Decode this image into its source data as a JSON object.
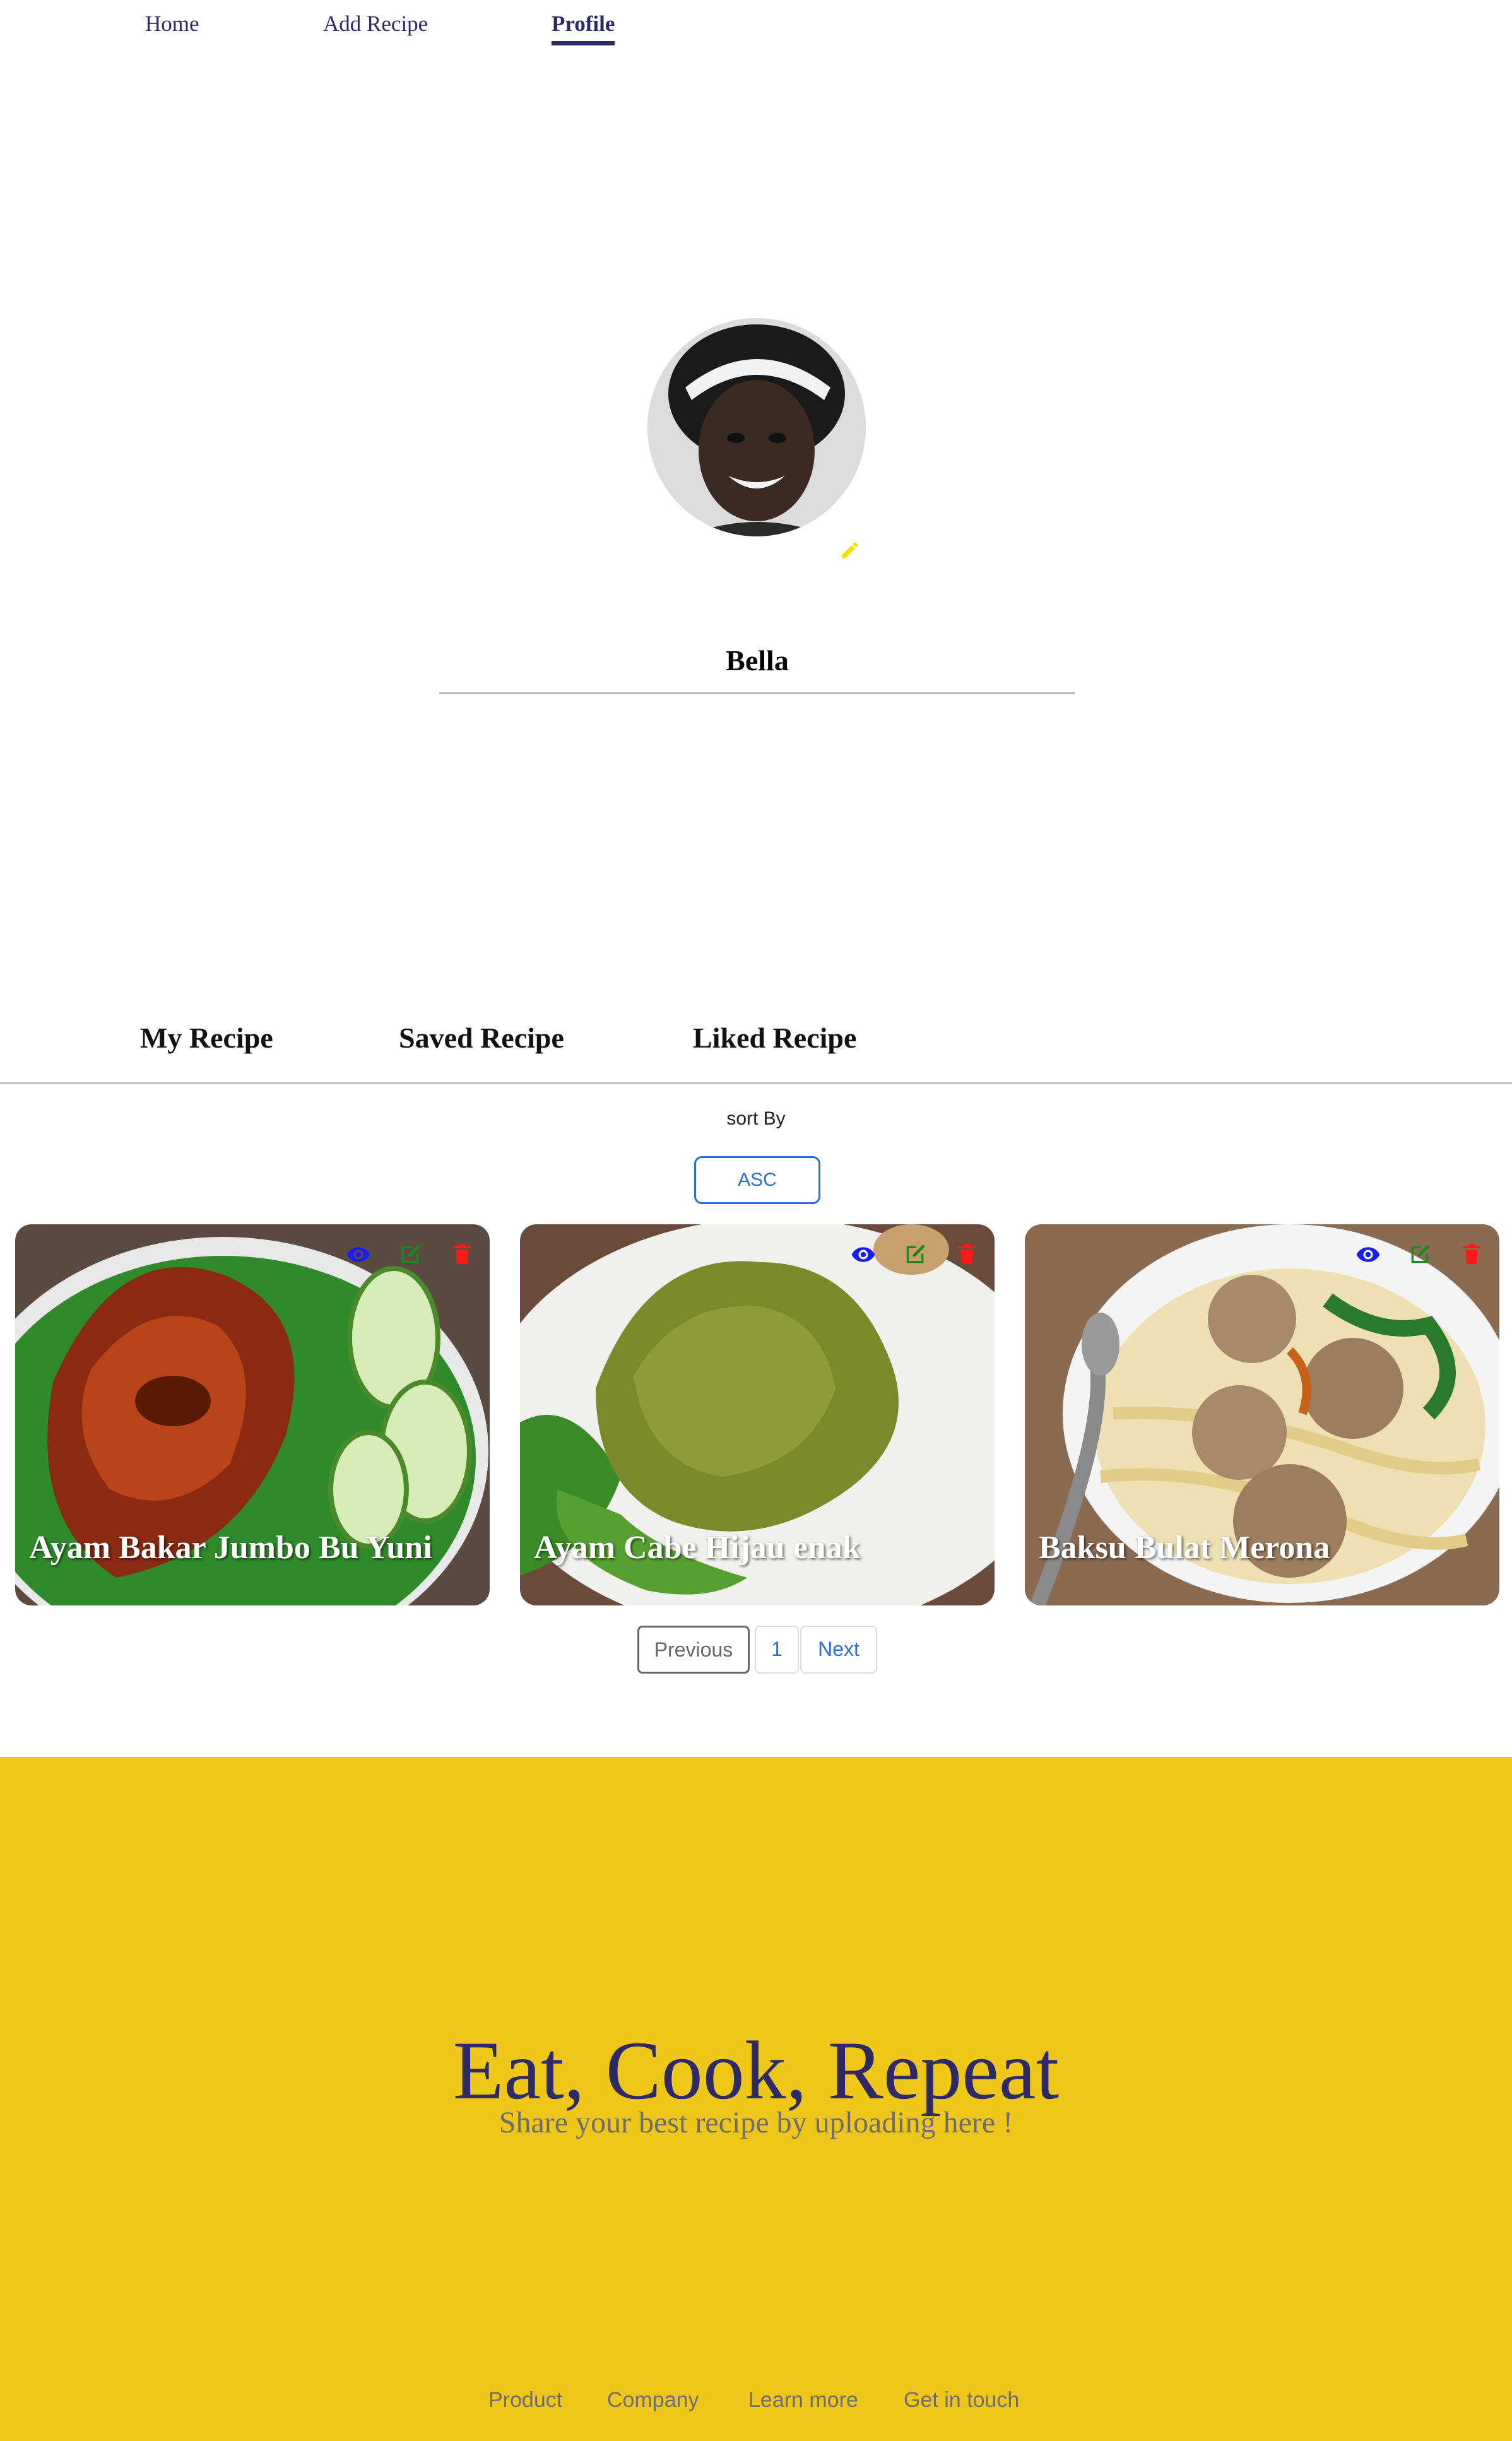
{
  "nav": {
    "home": "Home",
    "add_recipe": "Add Recipe",
    "profile": "Profile"
  },
  "profile": {
    "name": "Bella"
  },
  "tabs": {
    "my_recipe": "My Recipe",
    "saved_recipe": "Saved Recipe",
    "liked_recipe": "Liked Recipe"
  },
  "sort": {
    "label": "sort By",
    "button": "ASC"
  },
  "recipes": [
    {
      "title": "Ayam Bakar Jumbo Bu Yuni"
    },
    {
      "title": "Ayam Cabe Hijau enak"
    },
    {
      "title": "Baksu Bulat Merona"
    }
  ],
  "pagination": {
    "previous": "Previous",
    "page": "1",
    "next": "Next"
  },
  "footer": {
    "title": "Eat, Cook, Repeat",
    "subtitle": "Share your best recipe by uploading here !",
    "links": [
      "Product",
      "Company",
      "Learn more",
      "Get in touch"
    ]
  },
  "colors": {
    "brand_navy": "#2e2a66",
    "footer_yellow": "#eec71a",
    "accent_blue": "#2b6fd6",
    "view_icon": "#1a1aff",
    "edit_icon": "#1a8a1a",
    "delete_icon": "#ff1a1a",
    "pencil_icon": "#f5e000"
  },
  "icons": [
    "eye-icon",
    "edit-icon",
    "trash-icon",
    "pencil-icon"
  ]
}
